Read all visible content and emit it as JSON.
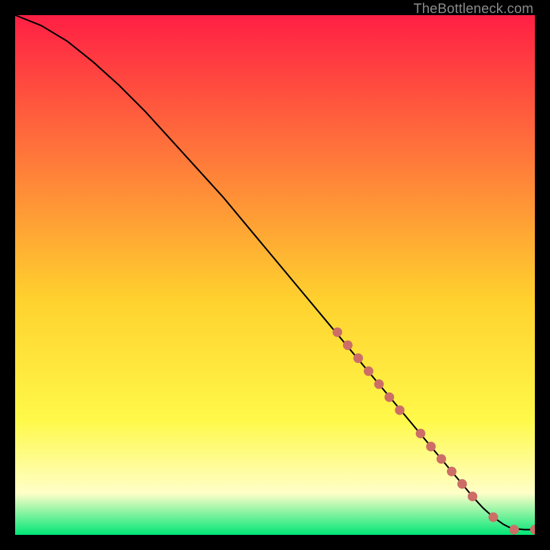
{
  "watermark": "TheBottleneck.com",
  "colors": {
    "gradient_top": "#ff1f44",
    "gradient_mid1": "#ff7a3a",
    "gradient_mid2": "#ffd22e",
    "gradient_mid3": "#fff94a",
    "gradient_pale": "#ffffc8",
    "gradient_bottom": "#00e676",
    "curve": "#000000",
    "dot": "#cc6e66"
  },
  "chart_data": {
    "type": "line",
    "title": "",
    "xlabel": "",
    "ylabel": "",
    "xlim": [
      0,
      100
    ],
    "ylim": [
      0,
      100
    ],
    "curve": {
      "x": [
        0,
        5,
        10,
        15,
        20,
        25,
        30,
        35,
        40,
        45,
        50,
        55,
        60,
        65,
        70,
        75,
        80,
        82,
        84,
        86,
        88,
        90,
        92,
        94,
        95,
        96,
        98,
        100
      ],
      "y": [
        100,
        98,
        95,
        91,
        86.5,
        81.5,
        76,
        70.5,
        65,
        59,
        53,
        47,
        41,
        35,
        29,
        23,
        17,
        14.6,
        12.2,
        9.8,
        7.4,
        5.2,
        3.4,
        2.0,
        1.5,
        1.2,
        1.0,
        1.0
      ]
    },
    "series": [
      {
        "name": "highlighted-points",
        "type": "scatter",
        "x": [
          62,
          64,
          66,
          68,
          70,
          72,
          74,
          78,
          80,
          82,
          84,
          86,
          88,
          92,
          96,
          100
        ],
        "y": [
          39,
          36.5,
          34,
          31.5,
          29,
          26.5,
          24,
          19.5,
          17,
          14.6,
          12.2,
          9.8,
          7.4,
          3.4,
          1.0,
          1.0
        ]
      }
    ]
  }
}
